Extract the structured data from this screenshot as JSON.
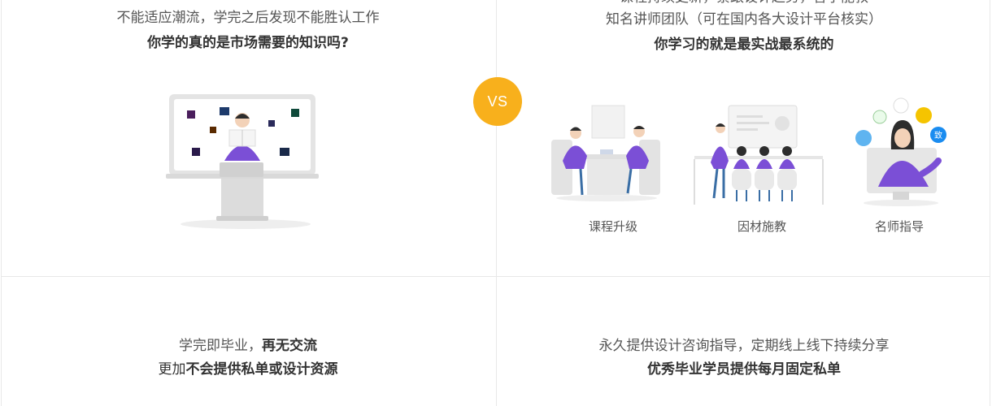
{
  "top_left": {
    "line_clipped": "——————————————",
    "line1": "不能适应潮流，学完之后发现不能胜认工作",
    "line2": "你学的真的是市场需要的知识吗?"
  },
  "top_right": {
    "line_clipped": "课程持续更新，紧跟设计趋势，智学能教",
    "line1": "知名讲师团队（可在国内各大设计平台核实）",
    "line2": "你学习的就是最实战最系统的",
    "features": [
      {
        "caption": "课程升级",
        "icon": "meeting-illustration"
      },
      {
        "caption": "因材施教",
        "icon": "classroom-illustration"
      },
      {
        "caption": "名师指导",
        "icon": "mentor-illustration"
      }
    ]
  },
  "vs": {
    "label": "VS"
  },
  "bottom_left": {
    "line1_prefix": "学完即毕业，",
    "line1_bold": "再无交流",
    "line2_prefix": "更加",
    "line2_bold": "不会提供私单或设计资源"
  },
  "bottom_right": {
    "line1": "永久提供设计咨询指导，定期线上线下持续分享",
    "line2": "优秀毕业学员提供每月固定私单"
  },
  "colors": {
    "accent": "#f8b01c",
    "purple": "#7b4fd6",
    "grey": "#d9d9d9"
  }
}
